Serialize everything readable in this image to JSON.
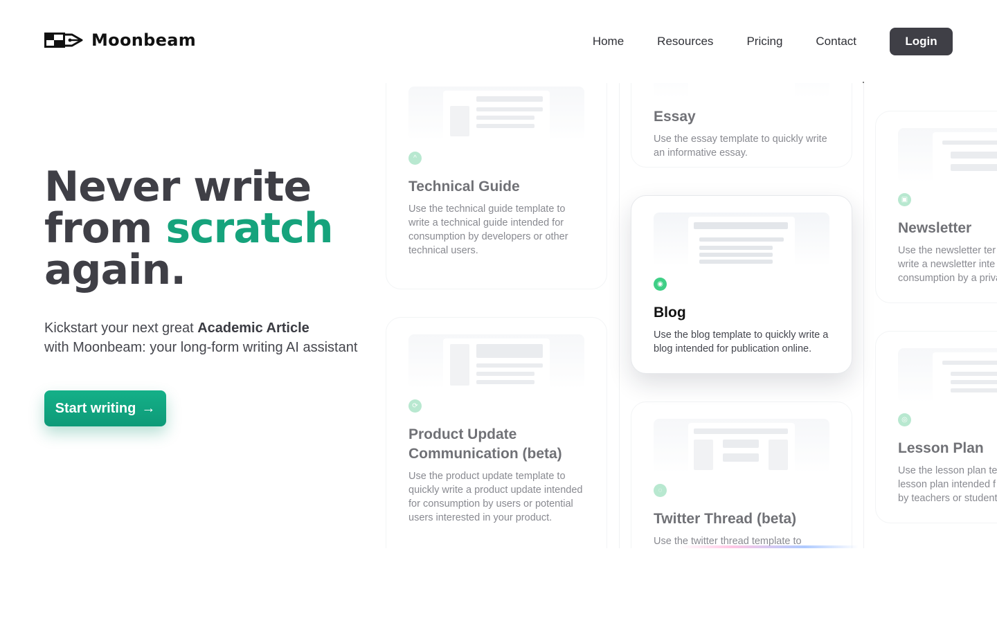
{
  "brand": {
    "name": "Moonbeam"
  },
  "nav": {
    "links": [
      "Home",
      "Resources",
      "Pricing",
      "Contact"
    ],
    "login_label": "Login"
  },
  "hero": {
    "title_line1": "Never write",
    "title_line2_prefix": "from ",
    "title_line2_accent": "scratch",
    "title_line3": "again.",
    "subtitle_prefix": "Kickstart your next great ",
    "subtitle_bold": "Academic Article",
    "subtitle_line2": "with Moonbeam: your long-form writing AI assistant",
    "cta_label": "Start writing",
    "cta_arrow": "→",
    "accent_color": "#16a37c"
  },
  "templates": [
    {
      "title": "Technical Guide",
      "description": "Use the technical guide template to write a technical guide intended for consumption by developers or other technical users.",
      "icon": "chevron-up-icon"
    },
    {
      "title": "Product Update Communication (beta)",
      "description": "Use the product update template to quickly write a product update intended for consumption by users or potential users interested in your product.",
      "icon": "refresh-icon"
    },
    {
      "title": "Essay",
      "description": "Use the essay template to quickly write an informative essay.",
      "icon": "document-icon"
    },
    {
      "title": "Blog",
      "description": "Use the blog template to quickly write a blog intended for publication online.",
      "icon": "rss-icon"
    },
    {
      "title": "Twitter Thread (beta)",
      "description": "Use the twitter thread template to",
      "icon": "chat-icon"
    },
    {
      "title": "Newsletter",
      "description": "Use the newsletter ter write a newsletter inte consumption by a priva",
      "icon": "newsletter-icon"
    },
    {
      "title": "Lesson Plan",
      "description": "Use the lesson plan te lesson plan intended f by teachers or student",
      "icon": "lesson-icon"
    }
  ]
}
